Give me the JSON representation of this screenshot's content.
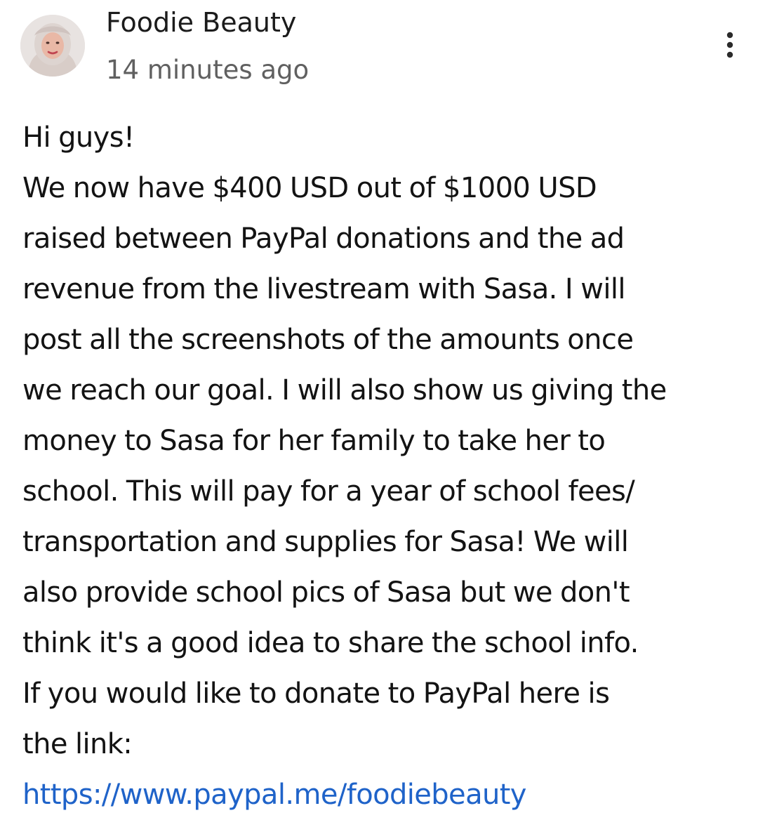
{
  "post": {
    "author": "Foodie Beauty",
    "timestamp": "14 minutes ago",
    "avatar_icon": "avatar",
    "menu_icon": "more-vertical-icon",
    "lines": [
      "Hi guys!",
      "We now have $400 USD out of $1000 USD",
      "raised between PayPal donations and the ad",
      "revenue from the livestream with Sasa. I will",
      "post all the screenshots of the amounts once",
      "we reach our goal. I will also show us giving the",
      "money to Sasa for her family to take her to",
      "school. This will pay for a year of school fees/",
      "transportation and supplies for Sasa! We will",
      "also provide school pics of Sasa but we don't",
      "think it's a good idea to share the school info.",
      "If you would like to donate to PayPal here is",
      "the link:"
    ],
    "link": "https://www.paypal.me/foodiebeauty"
  },
  "colors": {
    "link": "#1f63c9",
    "text": "#131313",
    "muted": "#606060"
  }
}
